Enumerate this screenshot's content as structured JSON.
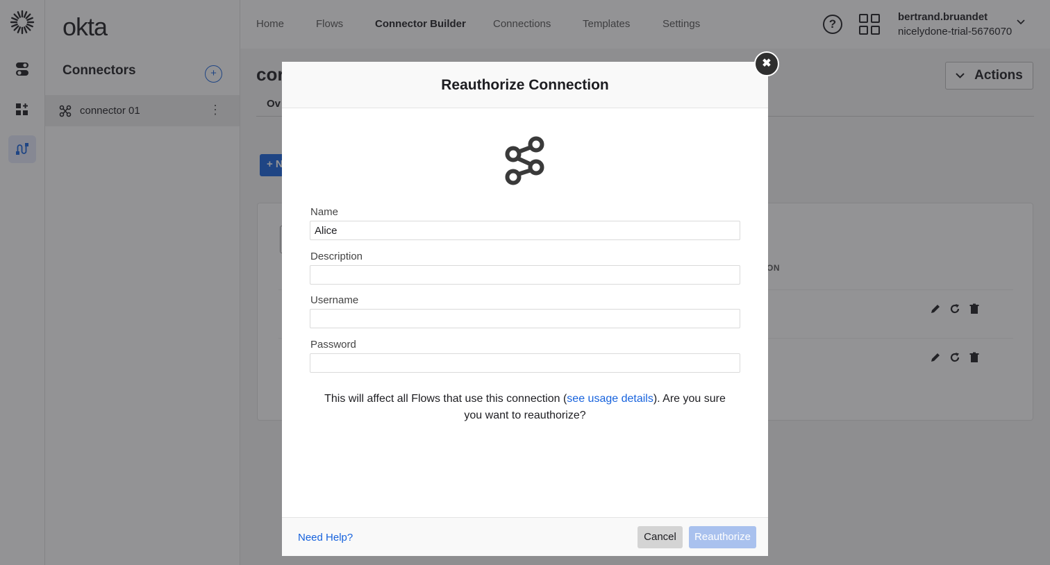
{
  "brand": {
    "wordmark": "okta",
    "accent": "#1662dd"
  },
  "rail": {
    "items": [
      {
        "name": "toggle-icon"
      },
      {
        "name": "add-widget-icon"
      },
      {
        "name": "connector-builder-icon",
        "active": true
      }
    ]
  },
  "sidebar": {
    "title": "Connectors",
    "add_label": "+",
    "items": [
      {
        "label": "connector 01"
      }
    ],
    "more_label": "⋮"
  },
  "topnav": {
    "items": [
      "Home",
      "Flows",
      "Connector Builder",
      "Connections",
      "Templates",
      "Settings"
    ],
    "active": "Connector Builder",
    "help_label": "?",
    "user_name": "bertrand.bruandet",
    "user_org": "nicelydone-trial-5676070"
  },
  "main": {
    "title": "cor",
    "tab": "Ov",
    "actions_label": "Actions",
    "new_label": "+ N",
    "column_header": "ON"
  },
  "modal": {
    "title": "Reauthorize Connection",
    "close_label": "✖",
    "fields": [
      {
        "label": "Name",
        "value": "Alice"
      },
      {
        "label": "Description",
        "value": ""
      },
      {
        "label": "Username",
        "value": ""
      },
      {
        "label": "Password",
        "value": ""
      }
    ],
    "warning_before": "This will affect all Flows that use this connection (",
    "warning_link": "see usage details",
    "warning_after": "). Are you sure you want to reauthorize?",
    "help_link": "Need Help?",
    "cancel_label": "Cancel",
    "reauthorize_label": "Reauthorize"
  }
}
